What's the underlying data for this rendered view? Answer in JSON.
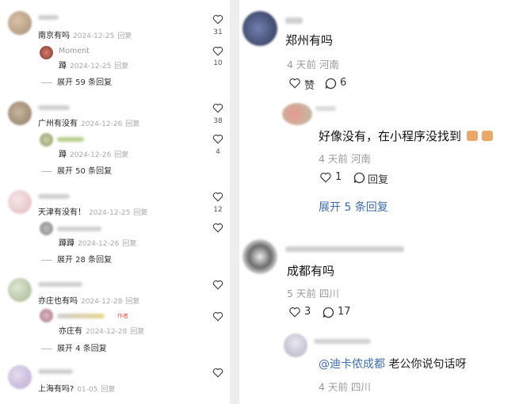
{
  "left": {
    "comments": [
      {
        "text": "南京有吗",
        "date": "2024-12-25",
        "reply_label": "回复",
        "likes": "31",
        "sub": {
          "name": "Moment",
          "text": "蹲",
          "date": "2024-12-25",
          "reply_label": "回复",
          "likes": "10"
        },
        "expand": "展开 59 条回复"
      },
      {
        "text": "广州有没有",
        "date": "2024-12-26",
        "reply_label": "回复",
        "likes": "38",
        "sub": {
          "text": "蹲",
          "date": "2024-12-26",
          "reply_label": "回复",
          "likes": "4"
        },
        "expand": "展开 50 条回复"
      },
      {
        "text": "天津有没有！",
        "date": "2024-12-25",
        "reply_label": "回复",
        "likes": "12",
        "sub": {
          "text": "蹲蹲",
          "date": "2024-12-26",
          "reply_label": "回复"
        },
        "expand": "展开 28 条回复"
      },
      {
        "text": "亦庄也有吗",
        "date": "2024-12-28",
        "reply_label": "回复",
        "sub": {
          "author_tag": "作者",
          "text": "亦庄有",
          "date": "2024-12-28",
          "reply_label": "回复"
        },
        "expand": "展开 4 条回复"
      },
      {
        "text": "上海有吗?",
        "date": "01-05",
        "reply_label": "回复"
      }
    ]
  },
  "right": {
    "c1": {
      "text": "郑州有吗",
      "meta": "4 天前  河南",
      "like_label": "赞",
      "reply_count": "6"
    },
    "r1": {
      "text": "好像没有，在小程序没找到",
      "meta": "4 天前  河南",
      "likes": "1",
      "reply_label": "回复",
      "expand": "展开 5 条回复"
    },
    "c2": {
      "text": "成都有吗",
      "meta": "5 天前  四川",
      "likes": "3",
      "reply_count": "17"
    },
    "r2": {
      "mention": "@迪卡侬成都",
      "text": " 老公你说句话呀",
      "meta": "4 天前  四川"
    }
  },
  "colors": {
    "accent_blue": "#3f6db0",
    "meta_gray": "#9a9a9a",
    "author_tag": "#e05a4a"
  }
}
